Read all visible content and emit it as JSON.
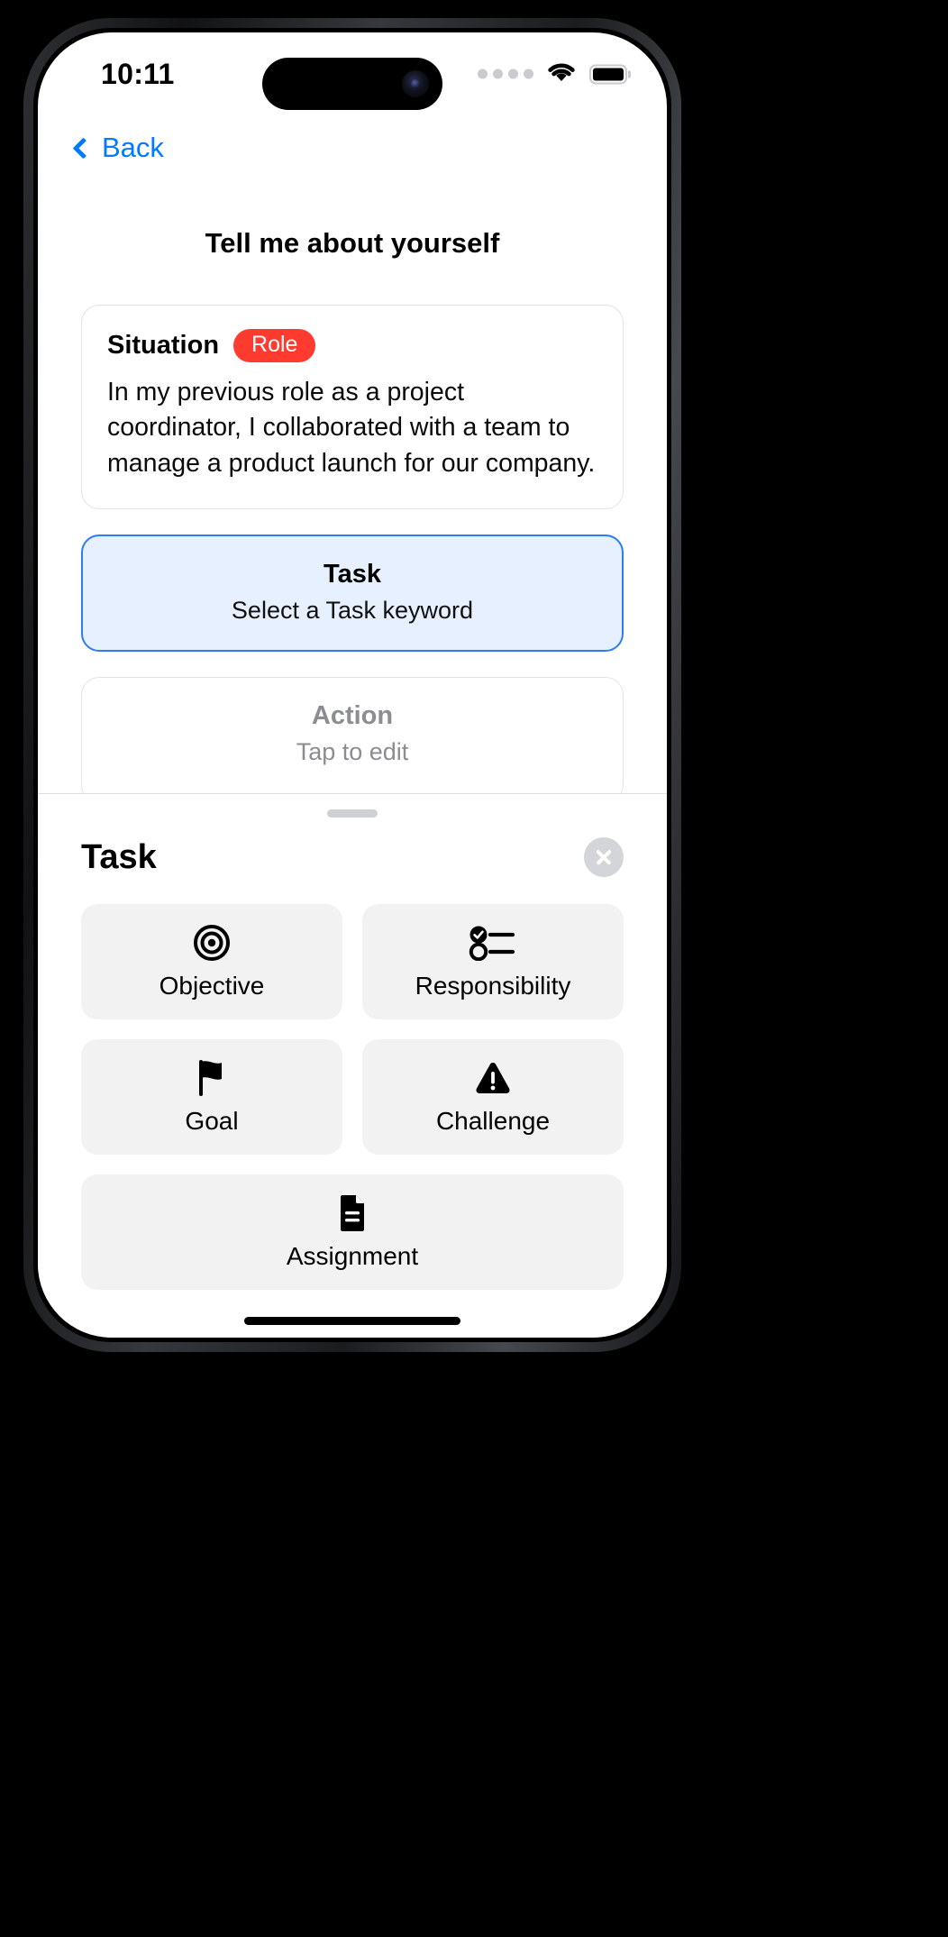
{
  "status_bar": {
    "time": "10:11",
    "signal_icon": "signal-dots-icon",
    "wifi_icon": "wifi-icon",
    "battery_icon": "battery-full-icon"
  },
  "nav": {
    "back_label": "Back",
    "back_icon": "chevron-left-icon"
  },
  "page": {
    "title": "Tell me about yourself"
  },
  "cards": [
    {
      "id": "situation",
      "state": "filled",
      "title": "Situation",
      "badge": "Role",
      "badge_color": "#FF3B30",
      "body": "In my previous role as a project coordinator, I collaborated with a team to manage a product launch for our company."
    },
    {
      "id": "task",
      "state": "selected",
      "title": "Task",
      "subtitle": "Select a Task keyword",
      "accent_color": "#2D7CF6",
      "fill_color": "#E6F0FE"
    },
    {
      "id": "action",
      "state": "empty",
      "title": "Action",
      "subtitle": "Tap to edit"
    }
  ],
  "sheet": {
    "title": "Task",
    "close_icon": "close-icon",
    "grip_icon": "drag-handle-icon",
    "options": [
      {
        "label": "Objective",
        "icon": "target-icon"
      },
      {
        "label": "Responsibility",
        "icon": "checklist-icon"
      },
      {
        "label": "Goal",
        "icon": "flag-icon"
      },
      {
        "label": "Challenge",
        "icon": "warning-triangle-icon"
      },
      {
        "label": "Assignment",
        "icon": "document-icon"
      }
    ]
  }
}
